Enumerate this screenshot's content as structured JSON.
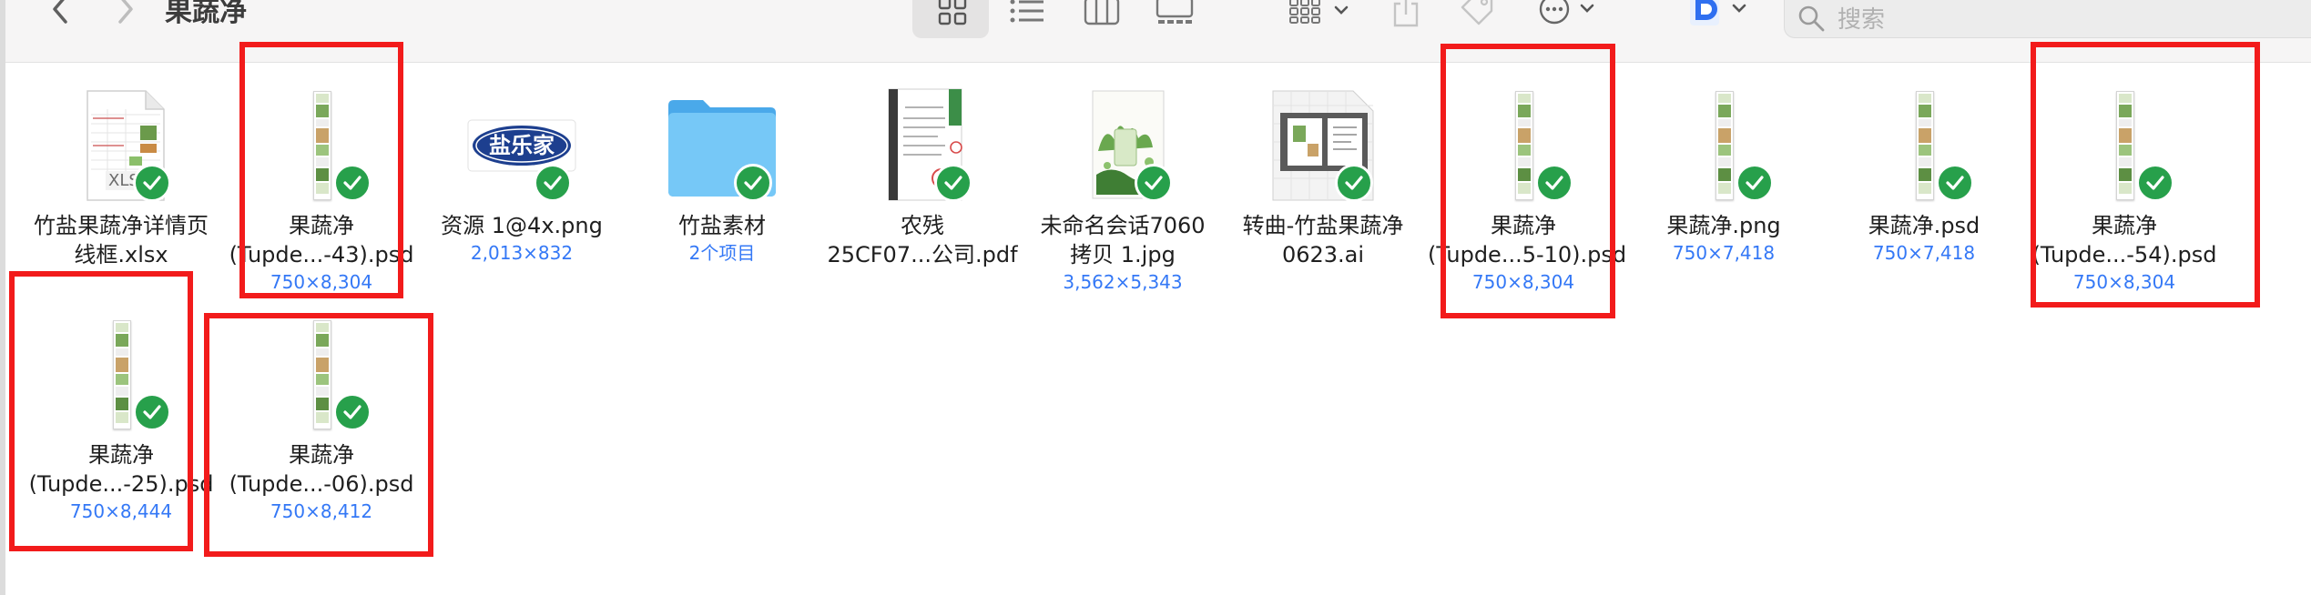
{
  "window": {
    "title": "果蔬净"
  },
  "toolbar": {
    "back_icon": "chevron-left-icon",
    "forward_icon": "chevron-right-icon",
    "view_icons": [
      "icon-view",
      "list-view",
      "column-view",
      "gallery-view"
    ],
    "group_icon": "group-icon",
    "share_icon": "share-icon",
    "tag_icon": "tag-icon",
    "more_icon": "ellipsis-circle-icon",
    "app_icon": "dingtalk-doc-icon",
    "search": {
      "placeholder": "搜索",
      "value": ""
    }
  },
  "files": [
    {
      "id": "f1",
      "name_lines": [
        "竹盐果蔬净详情页",
        "线框.xlsx"
      ],
      "meta": "",
      "kind": "xlsx",
      "badge": "XLSX",
      "synced": true
    },
    {
      "id": "f2",
      "name_lines": [
        "果蔬净",
        "(Tupde...-43).psd"
      ],
      "meta": "750×8,304",
      "kind": "psd",
      "synced": true,
      "highlighted": true
    },
    {
      "id": "f3",
      "name_lines": [
        "资源 1@4x.png"
      ],
      "meta": "2,013×832",
      "kind": "logo",
      "logo_text": "盐乐家",
      "synced": true
    },
    {
      "id": "f4",
      "name_lines": [
        "竹盐素材"
      ],
      "meta": "2个项目",
      "kind": "folder",
      "synced": true
    },
    {
      "id": "f5",
      "name_lines": [
        "农残",
        "25CF07...公司.pdf"
      ],
      "meta": "",
      "kind": "pdf",
      "synced": true
    },
    {
      "id": "f6",
      "name_lines": [
        "未命名会话7060",
        "拷贝 1.jpg"
      ],
      "meta": "3,562×5,343",
      "kind": "jpg",
      "synced": true
    },
    {
      "id": "f7",
      "name_lines": [
        "转曲-竹盐果蔬净",
        "0623.ai"
      ],
      "meta": "",
      "kind": "ai",
      "synced": true
    },
    {
      "id": "f8",
      "name_lines": [
        "果蔬净",
        "(Tupde...5-10).psd"
      ],
      "meta": "750×8,304",
      "kind": "psd",
      "synced": true,
      "highlighted": true
    },
    {
      "id": "f9",
      "name_lines": [
        "果蔬净.png"
      ],
      "meta": "750×7,418",
      "kind": "psd",
      "synced": true
    },
    {
      "id": "f10",
      "name_lines": [
        "果蔬净.psd"
      ],
      "meta": "750×7,418",
      "kind": "psd",
      "synced": true
    },
    {
      "id": "f11",
      "name_lines": [
        "果蔬净",
        "(Tupde...-54).psd"
      ],
      "meta": "750×8,304",
      "kind": "psd",
      "synced": true,
      "highlighted": true
    },
    {
      "id": "f12",
      "name_lines": [
        "果蔬净",
        "(Tupde...-25).psd"
      ],
      "meta": "750×8,444",
      "kind": "psd",
      "synced": true,
      "highlighted": true
    },
    {
      "id": "f13",
      "name_lines": [
        "果蔬净",
        "(Tupde...-06).psd"
      ],
      "meta": "750×8,412",
      "kind": "psd",
      "synced": true,
      "highlighted": true
    }
  ],
  "colors": {
    "accent": "#3478f6",
    "sync_check": "#27a04b",
    "highlight_box": "#f21b1b",
    "folder": "#6cc2f5"
  }
}
